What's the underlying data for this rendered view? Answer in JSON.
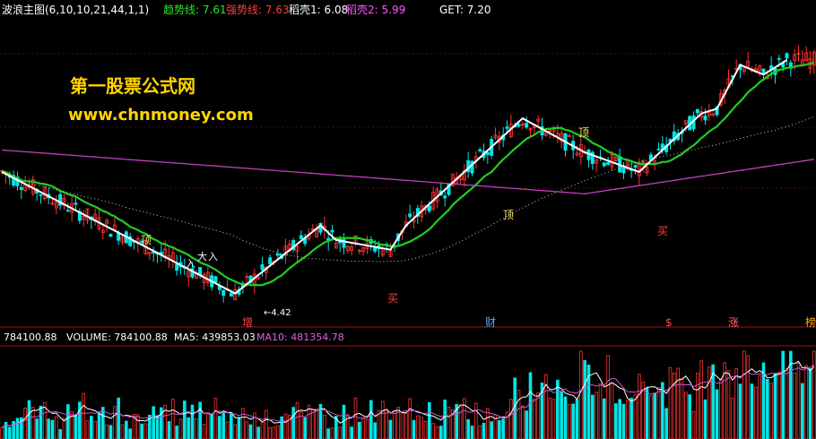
{
  "header": {
    "title": "波浪主图(6,10,10,21,44,1,1)",
    "items": [
      {
        "label": "趋势线",
        "value": "7.61",
        "color": "#29e629"
      },
      {
        "label": "强势线",
        "value": "7.63",
        "color": "#ff3b3b"
      },
      {
        "label": "稻壳1",
        "value": "6.08",
        "color": "#ffffff"
      },
      {
        "label": "稻壳2",
        "value": "5.99",
        "color": "#ff55ff"
      }
    ],
    "get": "GET: 7.20"
  },
  "watermark": {
    "line1": "第一股票公式网",
    "line2": "www.chnmoney.com"
  },
  "annotations": {
    "top_label": "顶",
    "bottom_label": "买",
    "increase": "增",
    "wealth": "财",
    "dollar": "$",
    "rise": "涨",
    "board": "榜",
    "low_marker": "←4.42",
    "arrow_labels": [
      "入",
      "大",
      "入"
    ]
  },
  "volume": {
    "truncated": "784100.88",
    "volume": "VOLUME: 784100.88",
    "ma5": "MA5: 439853.03",
    "ma10": "MA10: 481354.78"
  },
  "colors": {
    "up": "#ff3333",
    "down": "#00e6e6",
    "ma_green": "#22cc22",
    "ma_pink": "#c040c0",
    "wave": "#ffffff",
    "grid": "#aa1111",
    "vol_ma5": "#ffffff",
    "vol_ma10": "#cc55cc"
  },
  "chart_data": {
    "type": "candlestick",
    "price_low_label": 4.42,
    "wave_points": [
      {
        "idx": 0,
        "price": 6.95
      },
      {
        "idx": 60,
        "price": 4.45
      },
      {
        "idx": 82,
        "price": 5.85
      },
      {
        "idx": 86,
        "price": 5.55
      },
      {
        "idx": 100,
        "price": 5.35
      },
      {
        "idx": 104,
        "price": 5.85
      },
      {
        "idx": 134,
        "price": 8.05
      },
      {
        "idx": 150,
        "price": 7.35
      },
      {
        "idx": 164,
        "price": 6.95
      },
      {
        "idx": 180,
        "price": 8.15
      },
      {
        "idx": 184,
        "price": 8.25
      },
      {
        "idx": 190,
        "price": 9.15
      },
      {
        "idx": 196,
        "price": 8.95
      },
      {
        "idx": 202,
        "price": 9.25
      }
    ]
  }
}
